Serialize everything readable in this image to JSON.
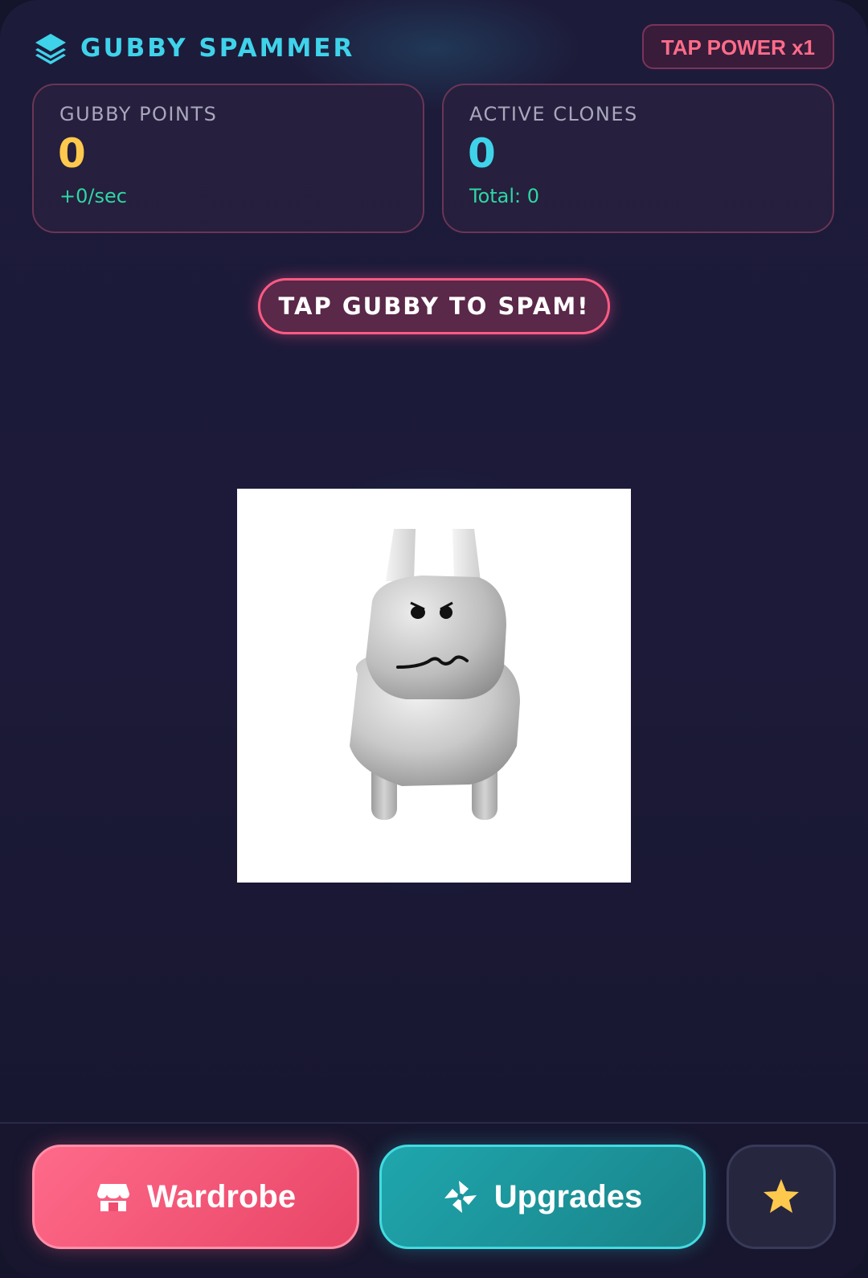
{
  "header": {
    "title": "GUBBY SPAMMER",
    "tap_power": "TAP POWER x1",
    "brand_icon": "layers-icon"
  },
  "stats": {
    "points": {
      "label": "GUBBY POINTS",
      "value": "0",
      "sub": "+0/sec"
    },
    "clones": {
      "label": "ACTIVE CLONES",
      "value": "0",
      "sub": "Total: 0"
    }
  },
  "main": {
    "tap_prompt": "TAP GUBBY TO SPAM!",
    "character": "gubby-character-image"
  },
  "bottom_nav": {
    "wardrobe": {
      "label": "Wardrobe",
      "icon": "shop-icon"
    },
    "upgrades": {
      "label": "Upgrades",
      "icon": "pinwheel-icon"
    },
    "favorites": {
      "icon": "star-icon"
    }
  },
  "colors": {
    "accent_cyan": "#3fd3ea",
    "accent_pink": "#ff6c8a",
    "points_yellow": "#ffc94d",
    "sub_green": "#2fd6a4",
    "background": "#1c1a38"
  }
}
